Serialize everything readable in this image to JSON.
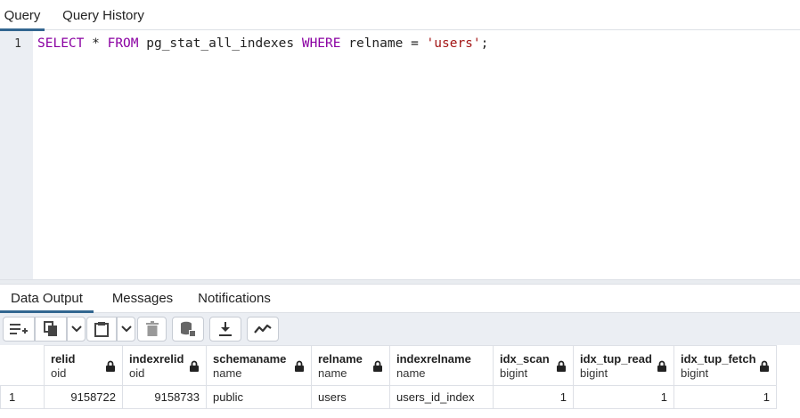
{
  "top_tabs": [
    "Query",
    "Query History"
  ],
  "editor": {
    "line_number": "1",
    "kw_select": "SELECT",
    "star": " * ",
    "kw_from": "FROM",
    "table": " pg_stat_all_indexes ",
    "kw_where": "WHERE",
    "condition": " relname = ",
    "string_value": "'users'",
    "terminator": ";"
  },
  "bottom_tabs": [
    "Data Output",
    "Messages",
    "Notifications"
  ],
  "toolbar": {
    "buttons": [
      "add-row-icon",
      "copy-icon",
      "chevron-down-icon",
      "paste-icon",
      "chevron-down-icon",
      "delete-icon",
      "save-data-icon",
      "download-icon",
      "graph-icon"
    ]
  },
  "grid": {
    "columns": [
      {
        "name": "relid",
        "type": "oid"
      },
      {
        "name": "indexrelid",
        "type": "oid"
      },
      {
        "name": "schemaname",
        "type": "name"
      },
      {
        "name": "relname",
        "type": "name"
      },
      {
        "name": "indexrelname",
        "type": "name"
      },
      {
        "name": "idx_scan",
        "type": "bigint"
      },
      {
        "name": "idx_tup_read",
        "type": "bigint"
      },
      {
        "name": "idx_tup_fetch",
        "type": "bigint"
      }
    ],
    "rows": [
      {
        "row_number": "1",
        "cells": [
          "9158722",
          "9158733",
          "public",
          "users",
          "users_id_index",
          "1",
          "1",
          "1"
        ]
      }
    ]
  },
  "colors": {
    "accent": "#326690",
    "keyword": "#8a00a2",
    "string": "#a31515",
    "panel_bg": "#ebeef3"
  }
}
